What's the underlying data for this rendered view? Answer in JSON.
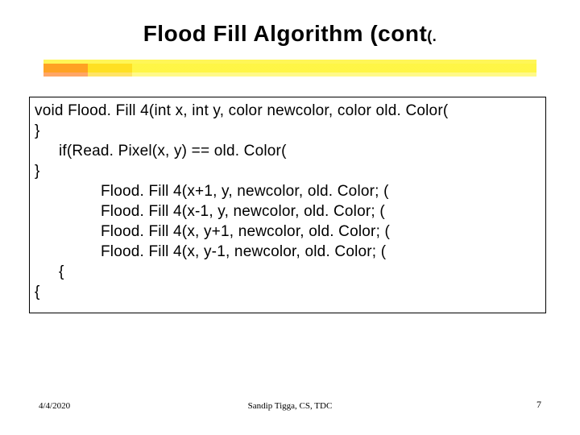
{
  "title": {
    "main": "Flood Fill Algorithm (cont",
    "suffix": "(."
  },
  "code": {
    "lines": [
      {
        "cls": "",
        "text": "void Flood. Fill 4(int x, int y, color newcolor, color old. Color("
      },
      {
        "cls": "",
        "text": "}"
      },
      {
        "cls": "ind1",
        "text": "if(Read. Pixel(x, y) == old. Color("
      },
      {
        "cls": "",
        "text": "}"
      },
      {
        "cls": "ind2",
        "text": "Flood. Fill 4(x+1, y, newcolor, old. Color; ("
      },
      {
        "cls": "ind2",
        "text": "Flood. Fill 4(x-1, y, newcolor, old. Color; ("
      },
      {
        "cls": "ind2",
        "text": "Flood. Fill 4(x, y+1, newcolor, old. Color; ("
      },
      {
        "cls": "ind2",
        "text": "Flood. Fill 4(x, y-1, newcolor, old. Color; ("
      },
      {
        "cls": "ind1",
        "text": "{"
      },
      {
        "cls": "",
        "text": "{"
      }
    ]
  },
  "footer": {
    "date": "4/4/2020",
    "author": "Sandip Tigga, CS, TDC",
    "page": "7"
  }
}
